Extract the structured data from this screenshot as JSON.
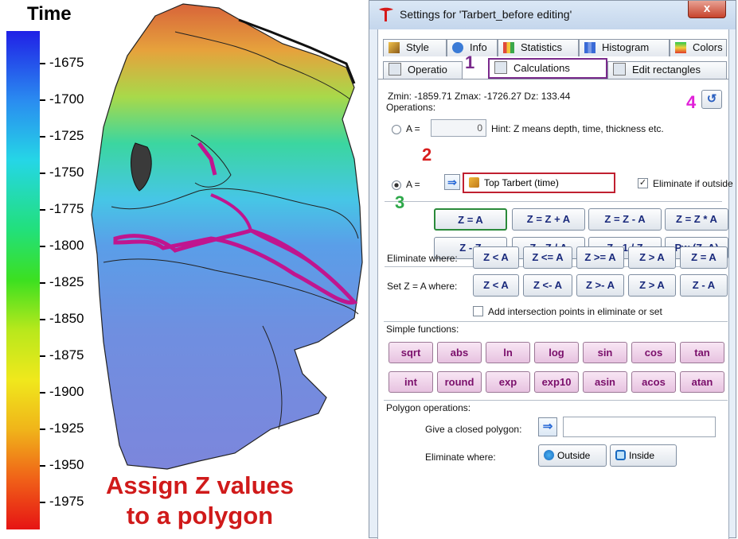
{
  "colorbar": {
    "title": "Time",
    "ticks": [
      "-1675",
      "-1700",
      "-1725",
      "-1750",
      "-1775",
      "-1800",
      "-1825",
      "-1850",
      "-1875",
      "-1900",
      "-1925",
      "-1950",
      "-1975"
    ]
  },
  "caption": {
    "line1": "Assign Z values",
    "line2": "to a polygon"
  },
  "dialog": {
    "title": "Settings for 'Tarbert_before editing'",
    "close": "x",
    "tabs_row1": [
      "Style",
      "Info",
      "Statistics",
      "Histogram",
      "Colors"
    ],
    "tabs_row2": [
      "Operatio",
      "Calculations",
      "Edit rectangles"
    ],
    "zinfo": "Zmin:  -1859.71    Zmax:  -1726.27    Dz:  133.44",
    "operations_label": "Operations:",
    "a_label": "A =",
    "a_value": "0",
    "hint": "Hint: Z means depth, time, thickness etc.",
    "a2_label": "A =",
    "surface_name": "Top Tarbert (time)",
    "eliminate_outside_label": "Eliminate if outside",
    "ops_row1": [
      "Z = A",
      "Z = Z + A",
      "Z = Z - A",
      "Z = Z * A"
    ],
    "ops_row2": [
      "Z - Z",
      "Z - Z / A",
      "Z - 1 / Z",
      "Pw (Z, A)"
    ],
    "eliminate_where_label": "Eliminate where:",
    "eliminate_ops": [
      "Z < A",
      "Z <= A",
      "Z >= A",
      "Z > A",
      "Z = A"
    ],
    "setz_label": "Set Z = A where:",
    "setz_ops": [
      "Z < A",
      "Z <- A",
      "Z >- A",
      "Z > A",
      "Z - A"
    ],
    "add_intersection_label": "Add intersection points in eliminate or set",
    "simple_functions_label": "Simple functions:",
    "functions_row1": [
      "sqrt",
      "abs",
      "ln",
      "log",
      "sin",
      "cos",
      "tan"
    ],
    "functions_row2": [
      "int",
      "round",
      "exp",
      "exp10",
      "asin",
      "acos",
      "atan"
    ],
    "polygon_operations_label": "Polygon operations:",
    "closed_polygon_label": "Give a closed polygon:",
    "polygon_eliminate_label": "Eliminate where:",
    "outside_label": "Outside",
    "inside_label": "Inside"
  },
  "annotations": {
    "n1": "1",
    "n2": "2",
    "n3": "3",
    "n4": "4"
  },
  "colors": {
    "annotation_1": "#7a2a8c",
    "annotation_2": "#d81e1e",
    "annotation_3": "#2ea84a",
    "annotation_4": "#e020d8",
    "polygon": "#c0158f"
  }
}
